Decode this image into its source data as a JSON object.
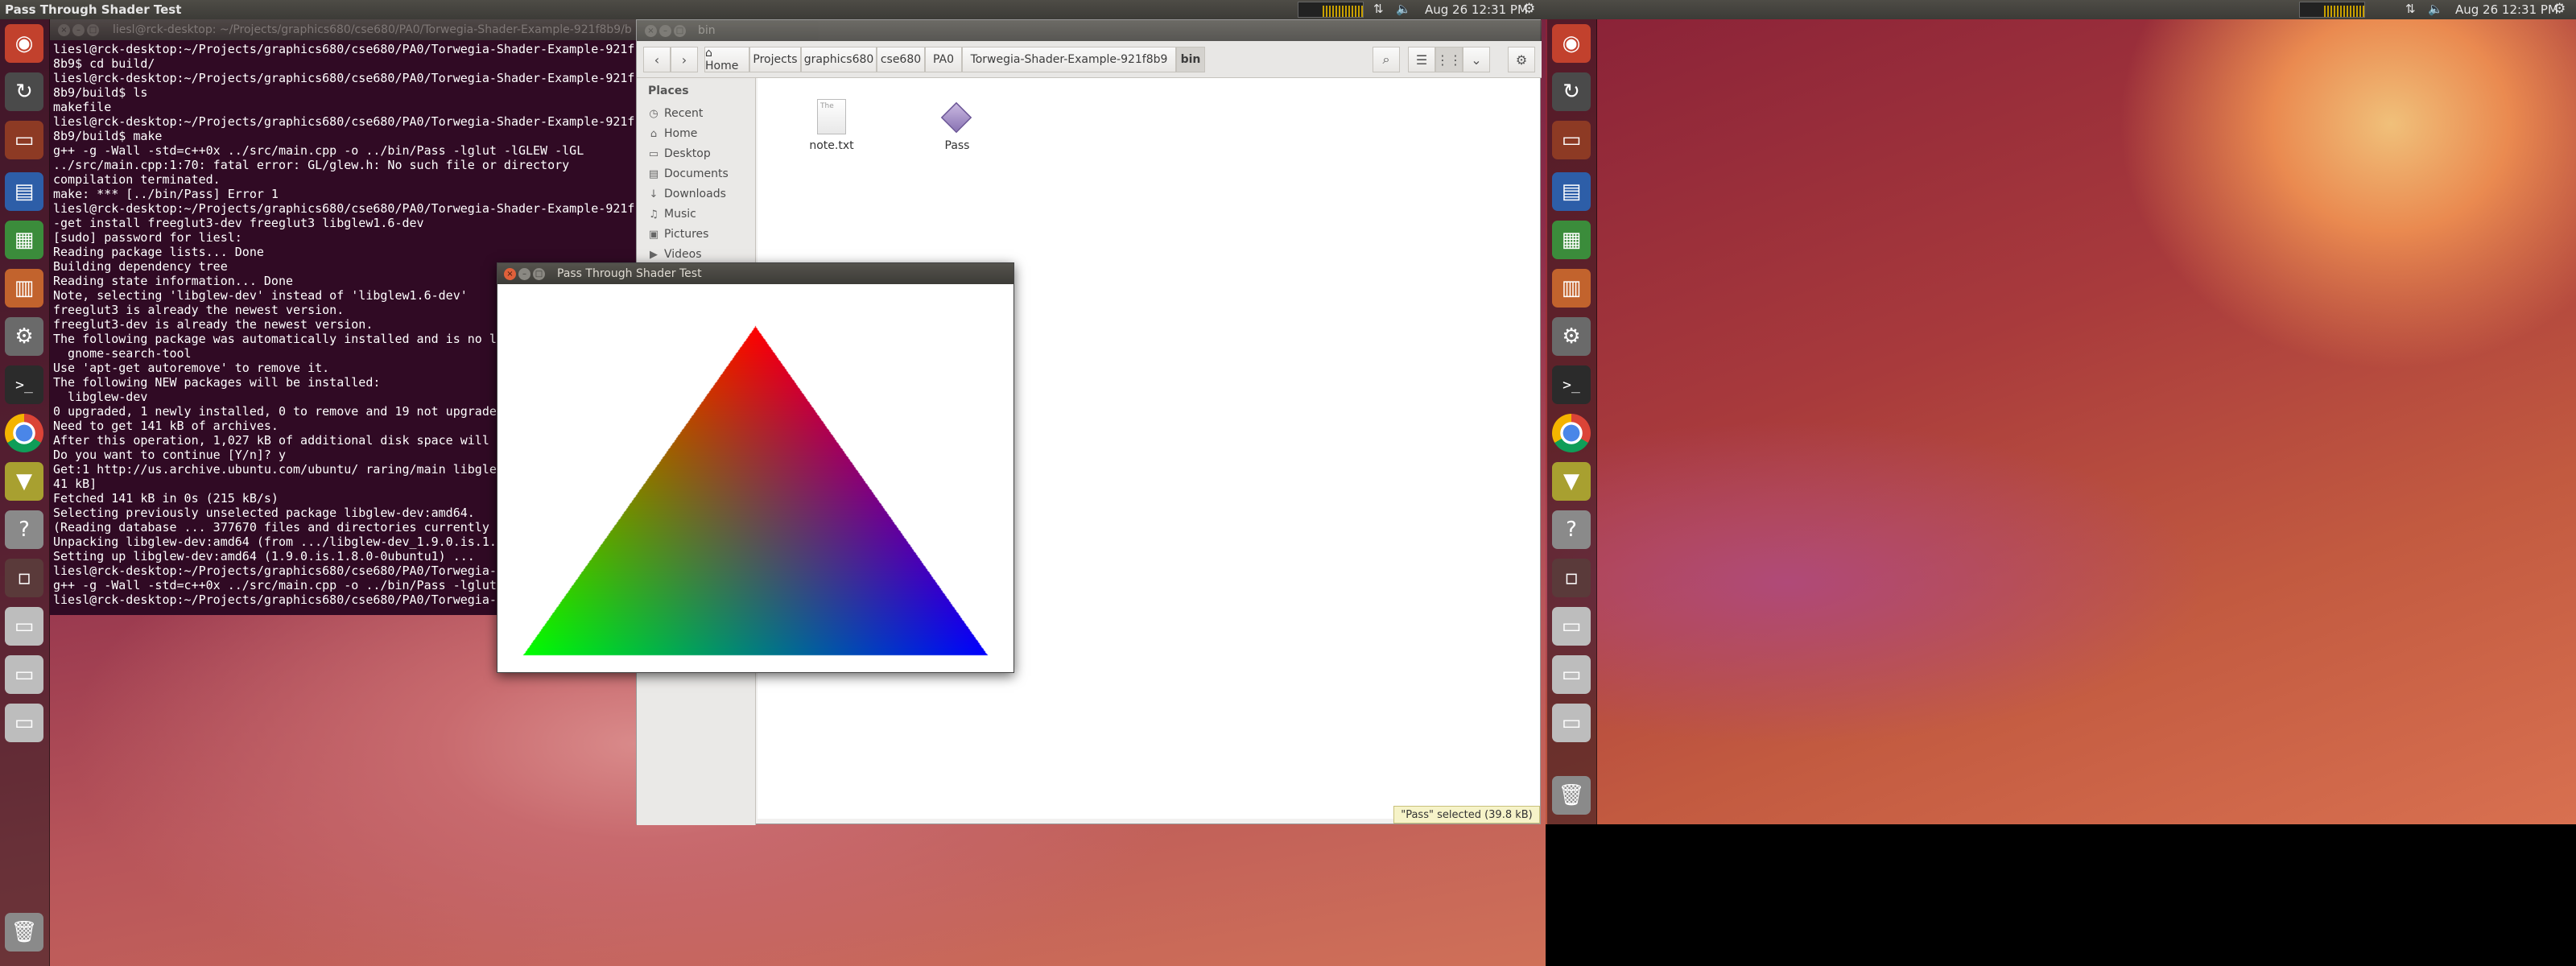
{
  "screen1": {
    "panel": {
      "title": "Pass Through Shader Test",
      "clock": "Aug 26  12:31 PM",
      "icons": [
        "network-monitor-icon",
        "network-icon",
        "volume-icon",
        "gear-icon"
      ]
    }
  },
  "screen2": {
    "panel": {
      "clock": "Aug 26  12:31 PM"
    }
  },
  "terminal": {
    "title": "liesl@rck-desktop: ~/Projects/graphics680/cse680/PA0/Torwegia-Shader-Example-921f8b9/b",
    "lines": [
      "liesl@rck-desktop:~/Projects/graphics680/cse680/PA0/Torwegia-Shader-Example-921f",
      "8b9$ cd build/",
      "liesl@rck-desktop:~/Projects/graphics680/cse680/PA0/Torwegia-Shader-Example-921f",
      "8b9/build$ ls",
      "makefile",
      "liesl@rck-desktop:~/Projects/graphics680/cse680/PA0/Torwegia-Shader-Example-921f",
      "8b9/build$ make",
      "g++ -g -Wall -std=c++0x ../src/main.cpp -o ../bin/Pass -lglut -lGLEW -lGL",
      "../src/main.cpp:1:70: fatal error: GL/glew.h: No such file or directory",
      "compilation terminated.",
      "make: *** [../bin/Pass] Error 1",
      "liesl@rck-desktop:~/Projects/graphics680/cse680/PA0/Torwegia-Shader-Example-921f",
      "-get install freeglut3-dev freeglut3 libglew1.6-dev",
      "[sudo] password for liesl:",
      "Reading package lists... Done",
      "Building dependency tree",
      "Reading state information... Done",
      "Note, selecting 'libglew-dev' instead of 'libglew1.6-dev'",
      "freeglut3 is already the newest version.",
      "freeglut3-dev is already the newest version.",
      "The following package was automatically installed and is no l",
      "  gnome-search-tool",
      "Use 'apt-get autoremove' to remove it.",
      "The following NEW packages will be installed:",
      "  libglew-dev",
      "0 upgraded, 1 newly installed, 0 to remove and 19 not upgrade",
      "Need to get 141 kB of archives.",
      "After this operation, 1,027 kB of additional disk space will",
      "Do you want to continue [Y/n]? y",
      "Get:1 http://us.archive.ubuntu.com/ubuntu/ raring/main libgle",
      "41 kB]",
      "Fetched 141 kB in 0s (215 kB/s)",
      "Selecting previously unselected package libglew-dev:amd64.",
      "(Reading database ... 377670 files and directories currently",
      "Unpacking libglew-dev:amd64 (from .../libglew-dev_1.9.0.is.1.",
      "Setting up libglew-dev:amd64 (1.9.0.is.1.8.0-0ubuntu1) ...",
      "liesl@rck-desktop:~/Projects/graphics680/cse680/PA0/Torwegia-",
      "g++ -g -Wall -std=c++0x ../src/main.cpp -o ../bin/Pass -lglut",
      "liesl@rck-desktop:~/Projects/graphics680/cse680/PA0/Torwegia-"
    ]
  },
  "files": {
    "title": "bin",
    "breadcrumbs": [
      "Home",
      "Projects",
      "graphics680",
      "cse680",
      "PA0",
      "Torwegia-Shader-Example-921f8b9",
      "bin"
    ],
    "places_heading": "Places",
    "places": [
      {
        "label": "Recent",
        "icon": "clock-icon",
        "glyph": "◷"
      },
      {
        "label": "Home",
        "icon": "home-icon",
        "glyph": "⌂"
      },
      {
        "label": "Desktop",
        "icon": "desktop-icon",
        "glyph": "▭"
      },
      {
        "label": "Documents",
        "icon": "documents-icon",
        "glyph": "▤"
      },
      {
        "label": "Downloads",
        "icon": "downloads-icon",
        "glyph": "↓"
      },
      {
        "label": "Music",
        "icon": "music-icon",
        "glyph": "♫"
      },
      {
        "label": "Pictures",
        "icon": "pictures-icon",
        "glyph": "▣"
      },
      {
        "label": "Videos",
        "icon": "videos-icon",
        "glyph": "▶"
      }
    ],
    "items": [
      {
        "name": "note.txt",
        "icon": "text-file-icon",
        "badge": "The"
      },
      {
        "name": "Pass",
        "icon": "executable-icon",
        "badge": ""
      }
    ],
    "status": "\"Pass\" selected  (39.8 kB)"
  },
  "glwindow": {
    "title": "Pass Through Shader Test",
    "colors": {
      "top": "#ff0000",
      "left": "#00ff00",
      "right": "#0000ff",
      "background": "#ffffff"
    }
  },
  "launcher_icons": [
    "ubuntu-dash-icon",
    "software-updater-icon",
    "files-icon",
    "libreoffice-writer-icon",
    "libreoffice-calc-icon",
    "libreoffice-impress-icon",
    "system-settings-icon",
    "terminal-icon",
    "chrome-icon",
    "archive-icon",
    "help-icon",
    "workspace-switcher-icon",
    "drive-icon",
    "drive-icon",
    "drive-icon",
    "trash-icon"
  ]
}
